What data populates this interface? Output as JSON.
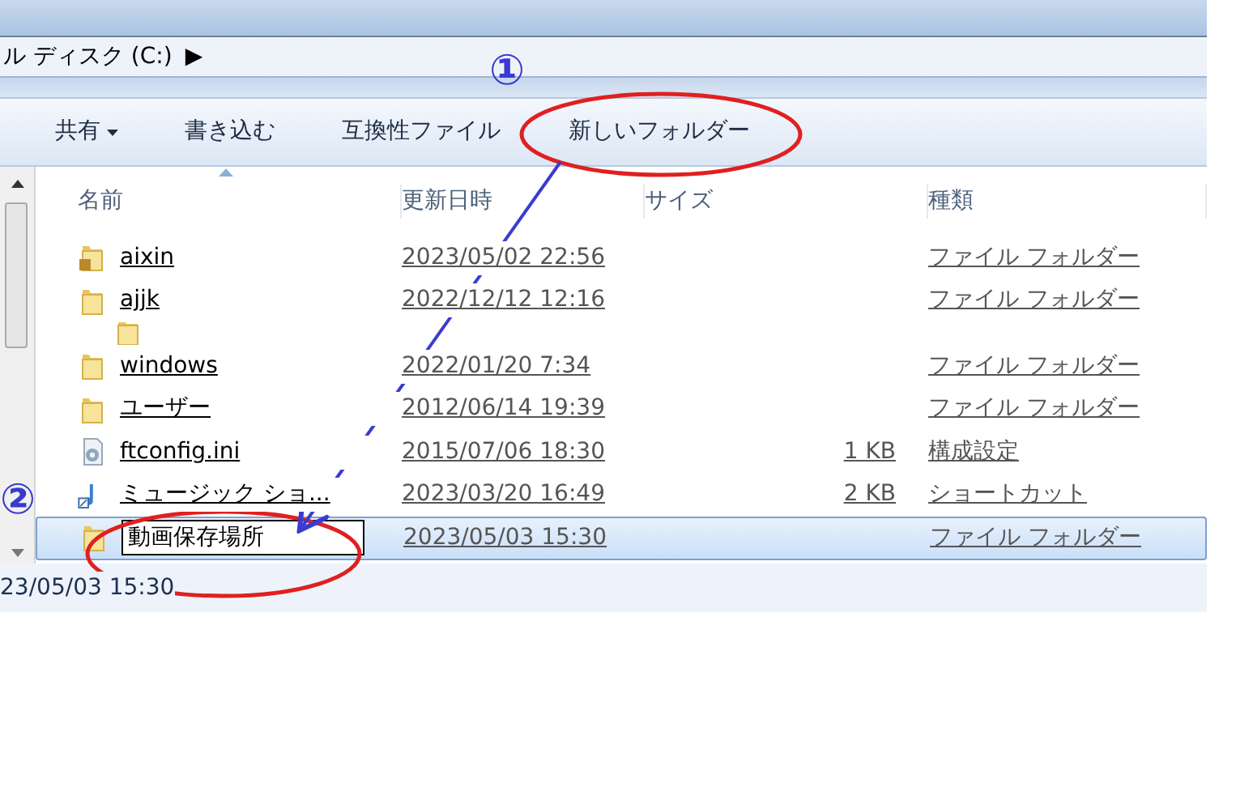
{
  "address_bar": {
    "path": "ル ディスク (C:)",
    "arrow": "▶"
  },
  "toolbar": [
    {
      "label": "共有",
      "dropdown": true
    },
    {
      "label": "書き込む",
      "dropdown": false
    },
    {
      "label": "互換性ファイル",
      "dropdown": false
    },
    {
      "label": "新しいフォルダー",
      "dropdown": false
    }
  ],
  "columns": [
    "名前",
    "更新日時",
    "サイズ",
    "種類"
  ],
  "files": [
    {
      "kind": "locked-folder",
      "name": "aixin",
      "modified": "2023/05/02 22:56",
      "type": "ファイル フォルダー",
      "selected": false
    },
    {
      "kind": "folder",
      "name": "ajjk",
      "modified": "2022/12/12 12:16",
      "type": "ファイル フォルダー",
      "selected": false
    },
    {
      "kind": "clipped"
    },
    {
      "kind": "folder",
      "name": "windows",
      "modified": "2022/01/20 7:34",
      "type": "ファイル フォルダー",
      "selected": false
    },
    {
      "kind": "folder",
      "name": "ユーザー",
      "modified": "2012/06/14 19:39",
      "type": "ファイル フォルダー",
      "selected": false
    },
    {
      "kind": "settings",
      "name": "ftconfig.ini",
      "modified": "2015/07/06 18:30",
      "size": "1 KB",
      "type": "構成設定",
      "selected": false
    },
    {
      "kind": "shortcut",
      "name": "ミュージック ショ...",
      "modified": "2023/03/20 16:49",
      "size": "2 KB",
      "type": "ショートカット",
      "selected": false
    },
    {
      "kind": "rename",
      "name": "動画保存場所",
      "modified": "2023/05/03 15:30",
      "type": "ファイル フォルダー",
      "selected": true
    }
  ],
  "status_bar": {
    "text": "23/05/03 15:30"
  },
  "annotations": [
    "①",
    "②"
  ]
}
